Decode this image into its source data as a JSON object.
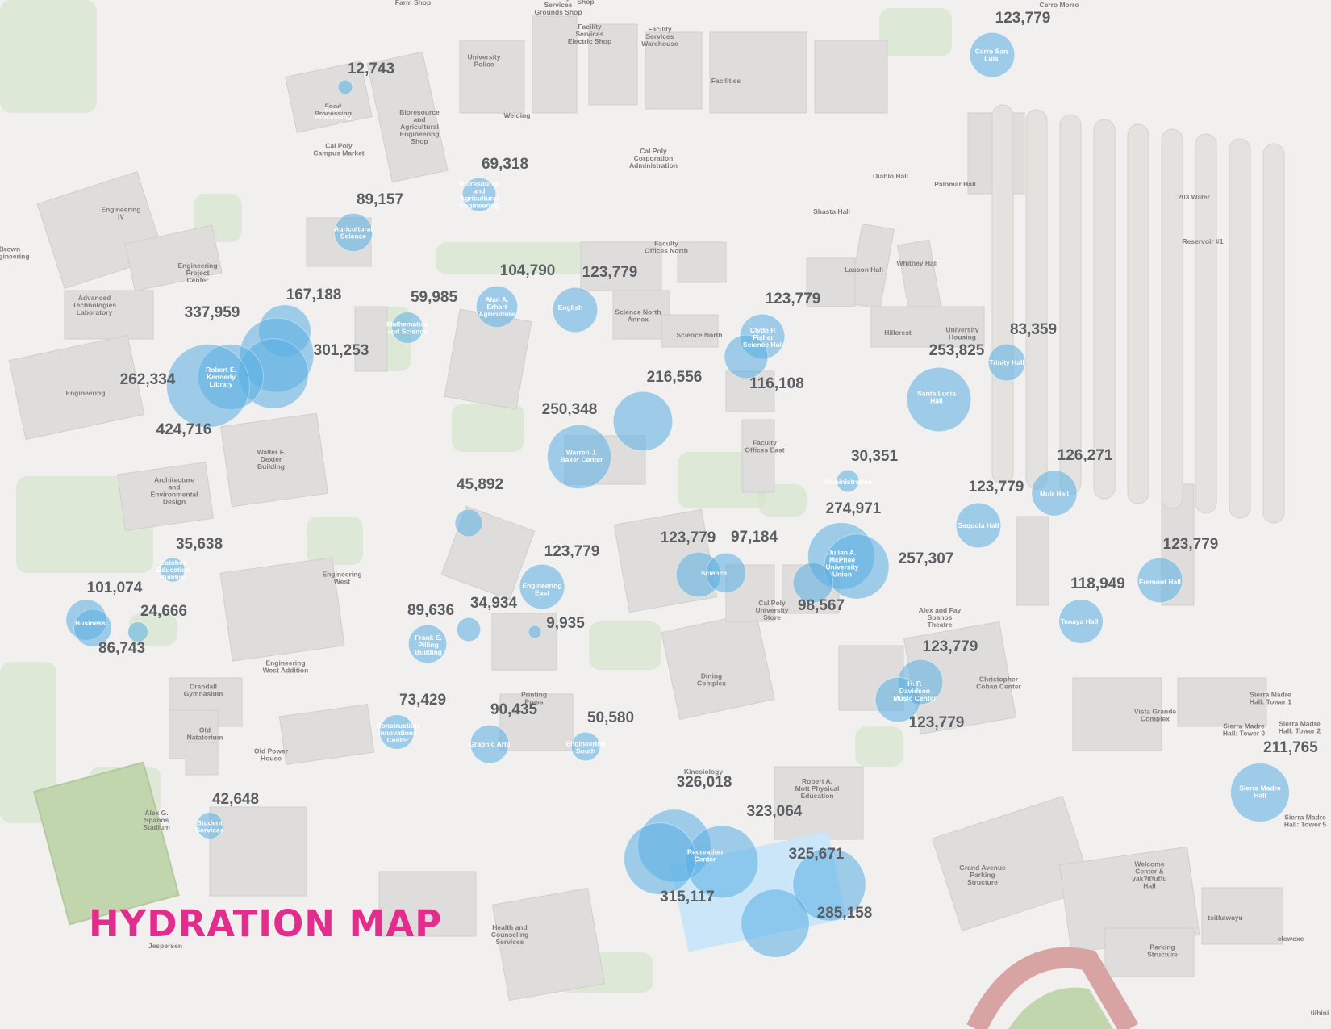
{
  "title": "HYDRATION MAP",
  "colors": {
    "background": "#f1f0ee",
    "building": "#dedddb",
    "green": "#d6e4cc",
    "bubble": "#5aaee3",
    "title": "#e22d8c",
    "track": "#d8a3a3",
    "field": "#c2d6ae",
    "water": "#cbe6f8"
  },
  "map_labels": [
    {
      "id": "farm-shop",
      "text": "Farm Shop"
    },
    {
      "id": "facility-services-grounds-shop",
      "text": "Facility Services Grounds Shop"
    },
    {
      "id": "shop",
      "text": "Shop"
    },
    {
      "id": "cerro-morro",
      "text": "Cerro Morro"
    },
    {
      "id": "university-police",
      "text": "University Police"
    },
    {
      "id": "facility-services-electric-shop",
      "text": "Facility Services Electric Shop"
    },
    {
      "id": "facility-services-warehouse",
      "text": "Facility Services Warehouse"
    },
    {
      "id": "facilities",
      "text": "Facilities"
    },
    {
      "id": "food-processing",
      "text": "Food Processing"
    },
    {
      "id": "welding",
      "text": "Welding"
    },
    {
      "id": "bioresource-shop",
      "text": "Bioresource and Agricultural Engineering Shop"
    },
    {
      "id": "cal-poly-campus-market",
      "text": "Cal Poly Campus Market"
    },
    {
      "id": "cal-poly-corporation",
      "text": "Cal Poly Corporation Administration"
    },
    {
      "id": "diablo-hall",
      "text": "Diablo Hall"
    },
    {
      "id": "palomar-hall",
      "text": "Palomar Hall"
    },
    {
      "id": "engineering-iv",
      "text": "Engineering IV"
    },
    {
      "id": "shasta-hall",
      "text": "Shasta Hall"
    },
    {
      "id": "water-203",
      "text": "203 Water"
    },
    {
      "id": "brown-engineering",
      "text": "Brown Engineering"
    },
    {
      "id": "reservoir-1",
      "text": "Reservoir #1"
    },
    {
      "id": "engineering-project-center",
      "text": "Engineering Project Center"
    },
    {
      "id": "faculty-offices-north",
      "text": "Faculty Offices North"
    },
    {
      "id": "lasson-hall",
      "text": "Lasson Hall"
    },
    {
      "id": "whitney-hall",
      "text": "Whitney Hall"
    },
    {
      "id": "advanced-technologies-laboratory",
      "text": "Advanced Technologies Laboratory"
    },
    {
      "id": "science-north-annex",
      "text": "Science North Annex"
    },
    {
      "id": "science-north",
      "text": "Science North"
    },
    {
      "id": "hillcrest",
      "text": "Hillcrest"
    },
    {
      "id": "university-housing",
      "text": "University Housing"
    },
    {
      "id": "engineering",
      "text": "Engineering"
    },
    {
      "id": "walter-dexter",
      "text": "Walter F. Dexter Building"
    },
    {
      "id": "faculty-offices-east",
      "text": "Faculty Offices East"
    },
    {
      "id": "architecture",
      "text": "Architecture and Environmental Design"
    },
    {
      "id": "engineering-west",
      "text": "Engineering West"
    },
    {
      "id": "cal-poly-university-store",
      "text": "Cal Poly University Store"
    },
    {
      "id": "alex-fay-spanos-theatre",
      "text": "Alex and Fay Spanos Theatre"
    },
    {
      "id": "engineering-west-addition",
      "text": "Engineering West Addition"
    },
    {
      "id": "dining-complex",
      "text": "Dining Complex"
    },
    {
      "id": "christopher-cohan-center",
      "text": "Christopher Cohan Center"
    },
    {
      "id": "crandall-gymnasium",
      "text": "Crandall Gymnasium"
    },
    {
      "id": "printing-press",
      "text": "Printing Press"
    },
    {
      "id": "vista-grande-complex",
      "text": "Vista Grande Complex"
    },
    {
      "id": "sierra-madre-tower-1",
      "text": "Sierra Madre Hall: Tower 1"
    },
    {
      "id": "old-natatorium",
      "text": "Old Natatorium"
    },
    {
      "id": "sierra-madre-tower-0",
      "text": "Sierra Madre Hall: Tower 0"
    },
    {
      "id": "sierra-madre-tower-2",
      "text": "Sierra Madre Hall: Tower 2"
    },
    {
      "id": "old-power-house",
      "text": "Old Power House"
    },
    {
      "id": "kinesiology",
      "text": "Kinesiology"
    },
    {
      "id": "alex-spanos-stadium",
      "text": "Alex G. Spanos Stadium"
    },
    {
      "id": "robert-mott",
      "text": "Robert A. Mott Physical Education"
    },
    {
      "id": "sierra-madre-tower-5",
      "text": "Sierra Madre Hall: Tower 5"
    },
    {
      "id": "grand-avenue-parking",
      "text": "Grand Avenue Parking Structure"
    },
    {
      "id": "welcome-center",
      "text": "Welcome Center & yakʔitʸutʸu Hall"
    },
    {
      "id": "tsitkawayu",
      "text": "tsɨtkawayu"
    },
    {
      "id": "elewexe",
      "text": "elewexe"
    },
    {
      "id": "health-counseling",
      "text": "Health and Counseling Services"
    },
    {
      "id": "parking-structure",
      "text": "Parking Structure"
    },
    {
      "id": "tithini",
      "text": "tiłhini"
    },
    {
      "id": "jespersen",
      "text": "Jespersen"
    }
  ],
  "bubble_labels": [
    {
      "id": "food-processing",
      "text": "Food Processing"
    },
    {
      "id": "agricultural-science",
      "text": "Agricultural Science"
    },
    {
      "id": "bioresource-engineering",
      "text": "Bioresource and Agricultural Engineering"
    },
    {
      "id": "mathematics-science",
      "text": "Mathematics and Science"
    },
    {
      "id": "alan-erhart",
      "text": "Alan A. Erhart Agriculture"
    },
    {
      "id": "english",
      "text": "English"
    },
    {
      "id": "robert-kennedy-library",
      "text": "Robert E. Kennedy Library"
    },
    {
      "id": "clyde-fisher",
      "text": "Clyde P. Fisher Science Hall"
    },
    {
      "id": "santa-lucia",
      "text": "Santa Lucia Hall"
    },
    {
      "id": "trinity",
      "text": "Trinity Hall"
    },
    {
      "id": "warren-baker",
      "text": "Warren J. Baker Center"
    },
    {
      "id": "administration",
      "text": "Administration"
    },
    {
      "id": "muir-hall",
      "text": "Muir Hall"
    },
    {
      "id": "sequoia-hall",
      "text": "Sequoia Hall"
    },
    {
      "id": "cotchett",
      "text": "Cotchett Education Building"
    },
    {
      "id": "business",
      "text": "Business"
    },
    {
      "id": "engineering-east",
      "text": "Engineering East"
    },
    {
      "id": "science",
      "text": "Science"
    },
    {
      "id": "julian-mcphee",
      "text": "Julian A. McPhee University Union"
    },
    {
      "id": "fremont-hall",
      "text": "Fremont Hall"
    },
    {
      "id": "tenaya-hall",
      "text": "Tenaya Hall"
    },
    {
      "id": "frank-pilling",
      "text": "Frank E. Pilling Building"
    },
    {
      "id": "davidson-music",
      "text": "H. P. Davidson Music Center"
    },
    {
      "id": "construction-innovations",
      "text": "Construction Innovations Center"
    },
    {
      "id": "graphic-arts",
      "text": "Graphic Arts"
    },
    {
      "id": "engineering-south",
      "text": "Engineering South"
    },
    {
      "id": "student-services",
      "text": "Student Services"
    },
    {
      "id": "recreation-center",
      "text": "Recreation Center"
    },
    {
      "id": "sierra-madre-hall",
      "text": "Sierra Madre Hall"
    },
    {
      "id": "cerro-san-luis",
      "text": "Cerro San Luis"
    }
  ],
  "bubbles": [
    {
      "id": "cerro-san-luis",
      "value": 123779,
      "label": "123,779"
    },
    {
      "id": "food-processing",
      "value": 12743,
      "label": "12,743"
    },
    {
      "id": "bioresource-engineering",
      "value": 69318,
      "label": "69,318"
    },
    {
      "id": "agricultural-science",
      "value": 89157,
      "label": "89,157"
    },
    {
      "id": "alan-erhart",
      "value": 104790,
      "label": "104,790"
    },
    {
      "id": "english",
      "value": 123779,
      "label": "123,779"
    },
    {
      "id": "mathematics-science",
      "value": 59985,
      "label": "59,985"
    },
    {
      "id": "library-a",
      "value": 167188,
      "label": "167,188"
    },
    {
      "id": "library-b",
      "value": 337959,
      "label": "337,959"
    },
    {
      "id": "library-c",
      "value": 301253,
      "label": "301,253"
    },
    {
      "id": "library-d",
      "value": 262334,
      "label": "262,334"
    },
    {
      "id": "library-e",
      "value": 424716,
      "label": "424,716"
    },
    {
      "id": "clyde-fisher",
      "value": 123779,
      "label": "123,779"
    },
    {
      "id": "clyde-fisher-b",
      "value": 116108,
      "label": "116,108"
    },
    {
      "id": "trinity",
      "value": 83359,
      "label": "83,359"
    },
    {
      "id": "santa-lucia",
      "value": 253825,
      "label": "253,825"
    },
    {
      "id": "baker-a",
      "value": 216556,
      "label": "216,556"
    },
    {
      "id": "warren-baker",
      "value": 250348,
      "label": "250,348"
    },
    {
      "id": "administration",
      "value": 30351,
      "label": "30,351"
    },
    {
      "id": "muir-hall",
      "value": 126271,
      "label": "126,271"
    },
    {
      "id": "sequoia-hall",
      "value": 123779,
      "label": "123,779"
    },
    {
      "id": "unknown-45892",
      "value": 45892,
      "label": "45,892"
    },
    {
      "id": "cotchett",
      "value": 35638,
      "label": "35,638"
    },
    {
      "id": "engineering-east",
      "value": 123779,
      "label": "123,779"
    },
    {
      "id": "science",
      "value": 123779,
      "label": "123,779"
    },
    {
      "id": "science-b",
      "value": 97184,
      "label": "97,184"
    },
    {
      "id": "union-a",
      "value": 274971,
      "label": "274,971"
    },
    {
      "id": "union-b",
      "value": 257307,
      "label": "257,307"
    },
    {
      "id": "union-c",
      "value": 98567,
      "label": "98,567"
    },
    {
      "id": "fremont-hall",
      "value": 123779,
      "label": "123,779"
    },
    {
      "id": "business-a",
      "value": 101074,
      "label": "101,074"
    },
    {
      "id": "business-b",
      "value": 24666,
      "label": "24,666"
    },
    {
      "id": "business-c",
      "value": 86743,
      "label": "86,743"
    },
    {
      "id": "tenaya-hall",
      "value": 118949,
      "label": "118,949"
    },
    {
      "id": "frank-pilling",
      "value": 89636,
      "label": "89,636"
    },
    {
      "id": "unknown-34934",
      "value": 34934,
      "label": "34,934"
    },
    {
      "id": "unknown-9935",
      "value": 9935,
      "label": "9,935"
    },
    {
      "id": "davidson-a",
      "value": 123779,
      "label": "123,779"
    },
    {
      "id": "davidson-b",
      "value": 123779,
      "label": "123,779"
    },
    {
      "id": "construction-innovations",
      "value": 73429,
      "label": "73,429"
    },
    {
      "id": "graphic-arts",
      "value": 90435,
      "label": "90,435"
    },
    {
      "id": "engineering-south",
      "value": 50580,
      "label": "50,580"
    },
    {
      "id": "sierra-madre-hall",
      "value": 211765,
      "label": "211,765"
    },
    {
      "id": "student-services",
      "value": 42648,
      "label": "42,648"
    },
    {
      "id": "rec-a",
      "value": 326018,
      "label": "326,018"
    },
    {
      "id": "rec-b",
      "value": 323064,
      "label": "323,064"
    },
    {
      "id": "rec-c",
      "value": 325671,
      "label": "325,671"
    },
    {
      "id": "rec-d",
      "value": 315117,
      "label": "315,117"
    },
    {
      "id": "rec-e",
      "value": 285158,
      "label": "285,158"
    }
  ]
}
